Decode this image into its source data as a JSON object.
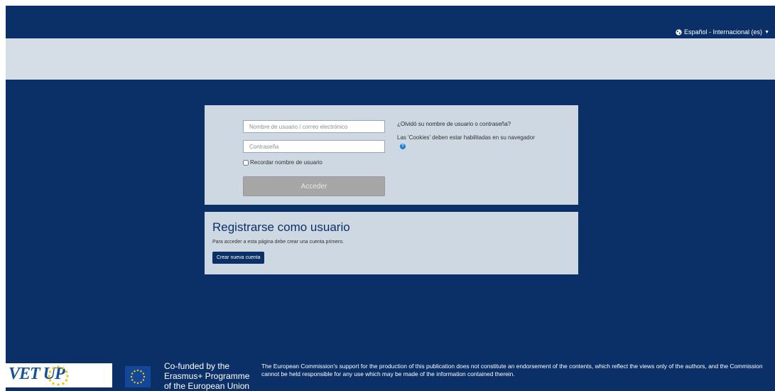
{
  "header": {
    "language_label": "Español - Internacional (es)",
    "language_icon": "globe-icon",
    "dropdown_icon": "caret-down-icon"
  },
  "login": {
    "username_placeholder": "Nombre de usuario / correo electrónico",
    "password_placeholder": "Contraseña",
    "remember_label": "Recordar nombre de usuario",
    "submit_label": "Acceder",
    "forgot_link": "¿Olvidó su nombre de usuario o contraseña?",
    "cookies_notice": "Las 'Cookies' deben estar habilitadas en su navegador",
    "help_icon": "question-circle-icon"
  },
  "register": {
    "title": "Registrarse como usuario",
    "text": "Para acceder a esta página debe crear una cuenta primero.",
    "button_label": "Crear nueva cuenta"
  },
  "footer": {
    "logo_text": "VET UP",
    "cofunded_lines": [
      "Co-funded by the",
      "Erasmus+ Programme",
      "of the European Union"
    ],
    "disclaimer": "The European Commission's support for the production of this publication does not constitute an endorsement of the contents, which reflect the views only of the authors, and the Commission cannot be held responsible for any use which may be made of the information contained therein."
  },
  "colors": {
    "primary": "#0b3068",
    "panel": "#ced8e2",
    "band": "#d5dde6",
    "disabled_button": "#a6a6a6",
    "help_icon": "#1f7bd3",
    "eu_blue": "#124799",
    "eu_star": "#ffcc00"
  }
}
